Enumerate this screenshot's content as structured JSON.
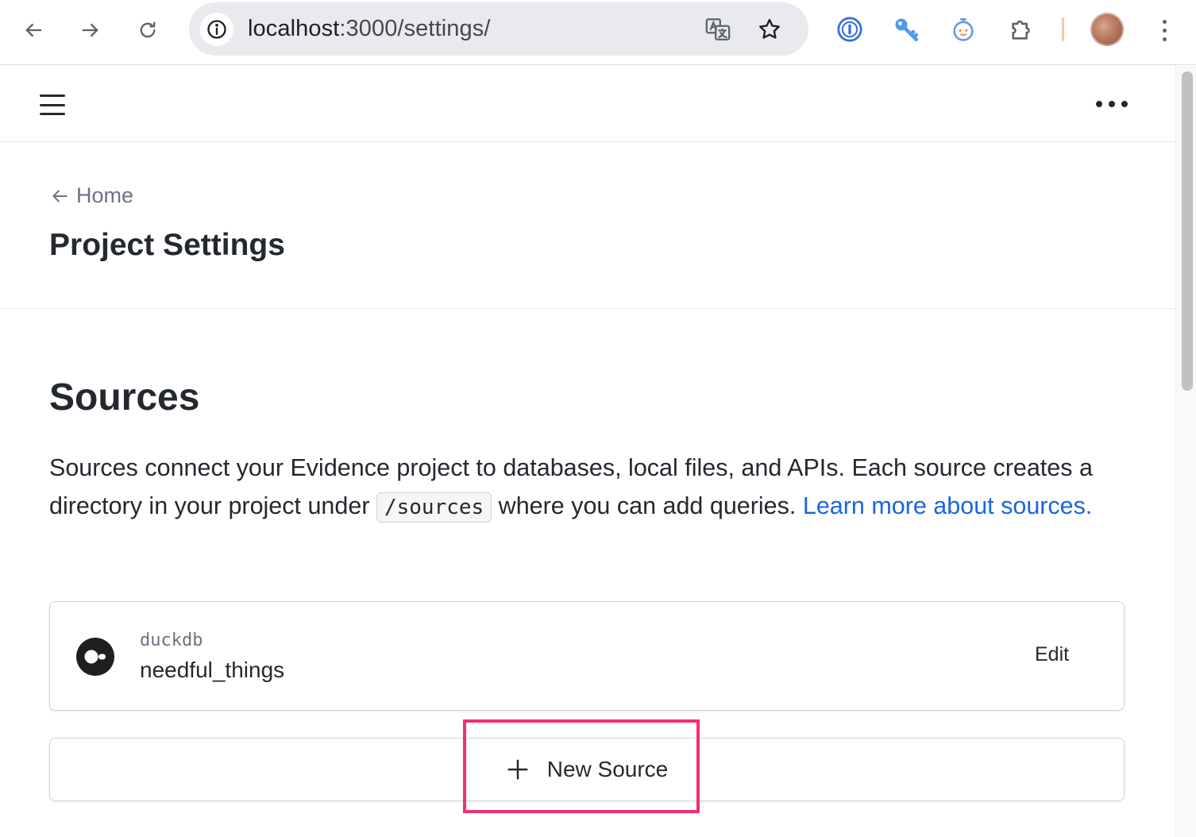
{
  "browser": {
    "url_host": "localhost",
    "url_path": ":3000/settings/",
    "icons": [
      "back-icon",
      "forward-icon",
      "reload-icon",
      "site-info-icon",
      "translate-icon",
      "bookmark-star-icon",
      "password-manager-icon",
      "key-extension-icon",
      "timer-extension-icon",
      "extensions-puzzle-icon",
      "profile-avatar",
      "browser-menu-icon"
    ]
  },
  "header": {
    "menu_icon": "hamburger-icon",
    "more_icon": "more-horizontal-icon"
  },
  "hero": {
    "back_label": "Home",
    "title": "Project Settings"
  },
  "sources": {
    "title": "Sources",
    "desc_part1": "Sources connect your Evidence project to databases, local files, and APIs. Each source creates a directory in your project under ",
    "desc_code": "/sources",
    "desc_part2": " where you can add queries. ",
    "desc_link": "Learn more about sources.",
    "items": [
      {
        "type": "duckdb",
        "name": "needful_things",
        "action": "Edit"
      }
    ],
    "new_label": "New Source"
  },
  "colors": {
    "link": "#1a66e0",
    "highlight": "#f0306f",
    "text": "#24292f"
  }
}
